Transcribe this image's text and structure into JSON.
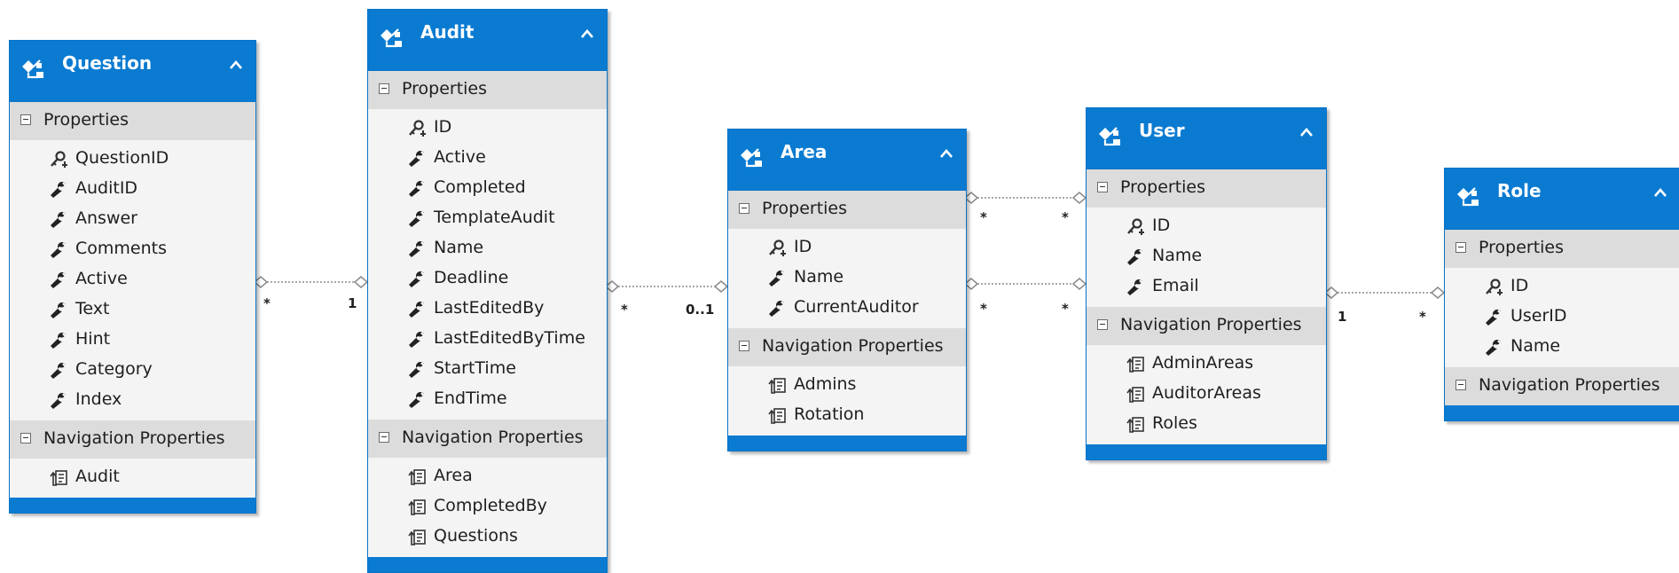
{
  "entities": [
    {
      "id": "question",
      "name": "Question",
      "properties_label": "Properties",
      "properties": [
        {
          "name": "QuestionID",
          "key": true
        },
        {
          "name": "AuditID",
          "key": false
        },
        {
          "name": "Answer",
          "key": false
        },
        {
          "name": "Comments",
          "key": false
        },
        {
          "name": "Active",
          "key": false
        },
        {
          "name": "Text",
          "key": false
        },
        {
          "name": "Hint",
          "key": false
        },
        {
          "name": "Category",
          "key": false
        },
        {
          "name": "Index",
          "key": false
        }
      ],
      "navigation_label": "Navigation Properties",
      "navigation": [
        "Audit"
      ]
    },
    {
      "id": "audit",
      "name": "Audit",
      "properties_label": "Properties",
      "properties": [
        {
          "name": "ID",
          "key": true
        },
        {
          "name": "Active",
          "key": false
        },
        {
          "name": "Completed",
          "key": false
        },
        {
          "name": "TemplateAudit",
          "key": false
        },
        {
          "name": "Name",
          "key": false
        },
        {
          "name": "Deadline",
          "key": false
        },
        {
          "name": "LastEditedBy",
          "key": false
        },
        {
          "name": "LastEditedByTime",
          "key": false
        },
        {
          "name": "StartTime",
          "key": false
        },
        {
          "name": "EndTime",
          "key": false
        }
      ],
      "navigation_label": "Navigation Properties",
      "navigation": [
        "Area",
        "CompletedBy",
        "Questions"
      ]
    },
    {
      "id": "area",
      "name": "Area",
      "properties_label": "Properties",
      "properties": [
        {
          "name": "ID",
          "key": true
        },
        {
          "name": "Name",
          "key": false
        },
        {
          "name": "CurrentAuditor",
          "key": false
        }
      ],
      "navigation_label": "Navigation Properties",
      "navigation": [
        "Admins",
        "Rotation"
      ]
    },
    {
      "id": "user",
      "name": "User",
      "properties_label": "Properties",
      "properties": [
        {
          "name": "ID",
          "key": true
        },
        {
          "name": "Name",
          "key": false
        },
        {
          "name": "Email",
          "key": false
        }
      ],
      "navigation_label": "Navigation Properties",
      "navigation": [
        "AdminAreas",
        "AuditorAreas",
        "Roles"
      ]
    },
    {
      "id": "role",
      "name": "Role",
      "properties_label": "Properties",
      "properties": [
        {
          "name": "ID",
          "key": true
        },
        {
          "name": "UserID",
          "key": false
        },
        {
          "name": "Name",
          "key": false
        }
      ],
      "navigation_label": "Navigation Properties",
      "navigation": []
    }
  ],
  "associations": [
    {
      "from": "question",
      "to": "audit",
      "from_mult": "*",
      "to_mult": "1"
    },
    {
      "from": "audit",
      "to": "area",
      "from_mult": "*",
      "to_mult": "0..1"
    },
    {
      "from": "area",
      "to": "user",
      "from_mult": "*",
      "to_mult": "*"
    },
    {
      "from": "area",
      "to": "user",
      "from_mult": "*",
      "to_mult": "*"
    },
    {
      "from": "user",
      "to": "role",
      "from_mult": "1",
      "to_mult": "*"
    }
  ],
  "colors": {
    "header": "#0a7bd1",
    "section": "#dcdcdc",
    "body": "#f4f4f4",
    "connector": "#8a8a8a"
  }
}
